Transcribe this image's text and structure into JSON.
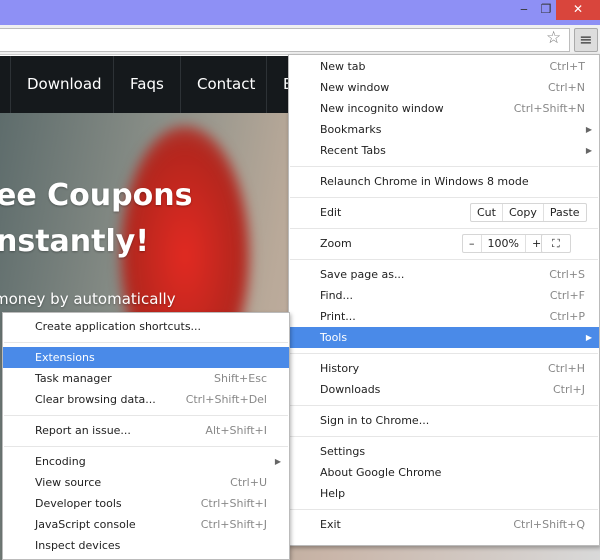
{
  "window": {
    "minimize": "‒",
    "maximize": "❐",
    "close": "✕"
  },
  "toolbar": {
    "star_icon": "star-icon",
    "menu_icon": "hamburger-icon",
    "star": "☆",
    "menu": "≡"
  },
  "page": {
    "nav": [
      "Download",
      "Faqs",
      "Contact",
      "E"
    ],
    "hero_line1": "ee Coupons",
    "hero_line2": "nstantly!",
    "hero_line3": "money by automatically"
  },
  "main_menu": [
    {
      "label": "New tab",
      "shortcut": "Ctrl+T"
    },
    {
      "label": "New window",
      "shortcut": "Ctrl+N"
    },
    {
      "label": "New incognito window",
      "shortcut": "Ctrl+Shift+N"
    },
    {
      "label": "Bookmarks",
      "submenu": true
    },
    {
      "label": "Recent Tabs",
      "submenu": true
    },
    {
      "sep": true
    },
    {
      "label": "Relaunch Chrome in Windows 8 mode"
    },
    {
      "sep": true
    },
    {
      "label": "Edit",
      "buttons": [
        "Cut",
        "Copy",
        "Paste"
      ]
    },
    {
      "sep": true
    },
    {
      "label": "Zoom",
      "zoom": {
        "minus": "–",
        "value": "100%",
        "plus": "+",
        "fullscreen": "⛶"
      }
    },
    {
      "sep": true
    },
    {
      "label": "Save page as...",
      "shortcut": "Ctrl+S"
    },
    {
      "label": "Find...",
      "shortcut": "Ctrl+F"
    },
    {
      "label": "Print...",
      "shortcut": "Ctrl+P"
    },
    {
      "label": "Tools",
      "submenu": true,
      "highlighted": true
    },
    {
      "sep": true
    },
    {
      "label": "History",
      "shortcut": "Ctrl+H"
    },
    {
      "label": "Downloads",
      "shortcut": "Ctrl+J"
    },
    {
      "sep": true
    },
    {
      "label": "Sign in to Chrome..."
    },
    {
      "sep": true
    },
    {
      "label": "Settings"
    },
    {
      "label": "About Google Chrome"
    },
    {
      "label": "Help"
    },
    {
      "sep": true
    },
    {
      "label": "Exit",
      "shortcut": "Ctrl+Shift+Q"
    }
  ],
  "tools_menu": [
    {
      "label": "Create application shortcuts..."
    },
    {
      "sep": true
    },
    {
      "label": "Extensions",
      "highlighted": true
    },
    {
      "label": "Task manager",
      "shortcut": "Shift+Esc"
    },
    {
      "label": "Clear browsing data...",
      "shortcut": "Ctrl+Shift+Del"
    },
    {
      "sep": true
    },
    {
      "label": "Report an issue...",
      "shortcut": "Alt+Shift+I"
    },
    {
      "sep": true
    },
    {
      "label": "Encoding",
      "submenu": true
    },
    {
      "label": "View source",
      "shortcut": "Ctrl+U"
    },
    {
      "label": "Developer tools",
      "shortcut": "Ctrl+Shift+I"
    },
    {
      "label": "JavaScript console",
      "shortcut": "Ctrl+Shift+J"
    },
    {
      "label": "Inspect devices"
    }
  ],
  "colors": {
    "titlebar": "#8e90f5",
    "highlight": "#4a8ae8",
    "close": "#d9453c"
  }
}
